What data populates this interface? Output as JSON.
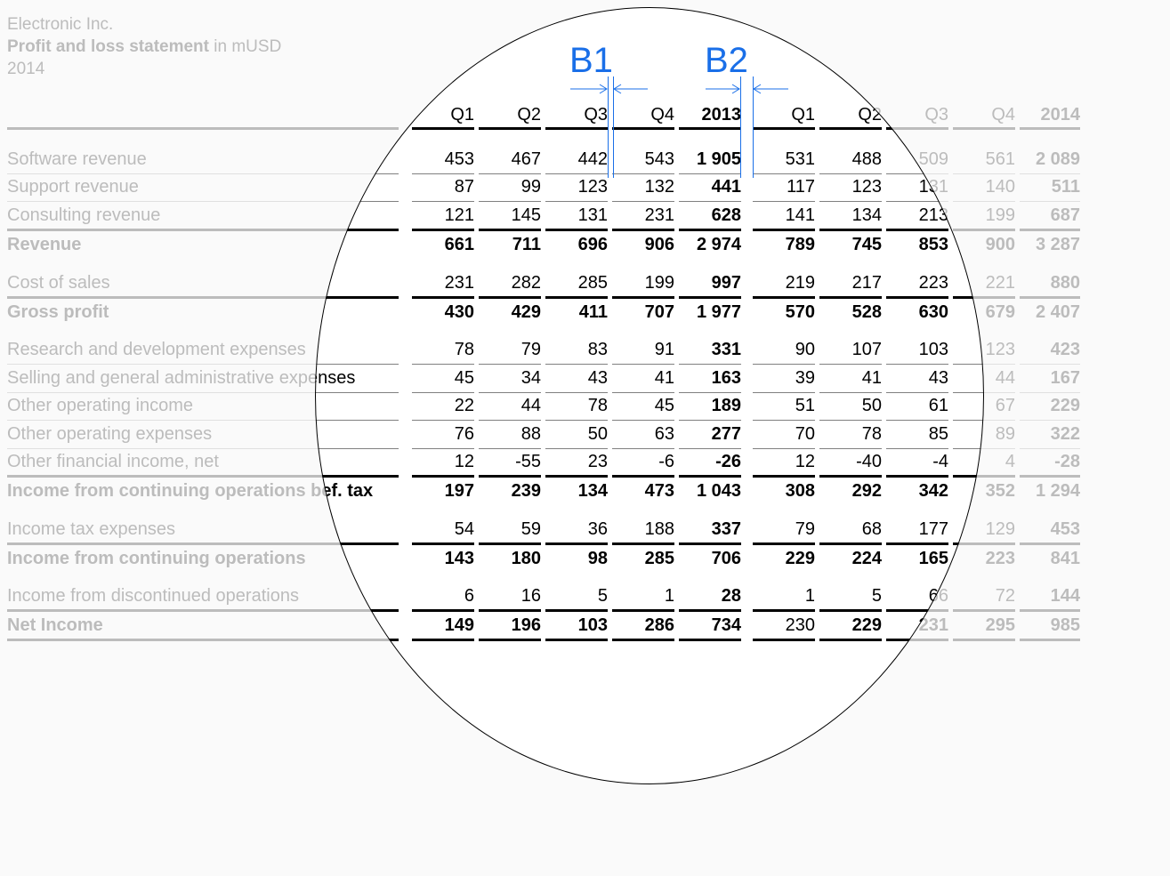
{
  "header": {
    "company": "Electronic Inc.",
    "title_bold": "Profit and loss statement",
    "title_unit": " in mUSD",
    "year": "2014"
  },
  "columns": [
    "Q1",
    "Q2",
    "Q3",
    "Q4",
    "2013",
    "Q1",
    "Q2",
    "Q3",
    "Q4",
    "2014"
  ],
  "markers": {
    "b1": "B1",
    "b2": "B2"
  },
  "rows": [
    {
      "label": "Software revenue",
      "bold": false,
      "values": [
        "453",
        "467",
        "442",
        "543",
        "1 905",
        "531",
        "488",
        "509",
        "561",
        "2 089"
      ]
    },
    {
      "label": "Support revenue",
      "bold": false,
      "values": [
        "87",
        "99",
        "123",
        "132",
        "441",
        "117",
        "123",
        "131",
        "140",
        "511"
      ]
    },
    {
      "label": "Consulting revenue",
      "bold": false,
      "values": [
        "121",
        "145",
        "131",
        "231",
        "628",
        "141",
        "134",
        "213",
        "199",
        "687"
      ]
    },
    {
      "label": "Revenue",
      "bold": true,
      "values": [
        "661",
        "711",
        "696",
        "906",
        "2 974",
        "789",
        "745",
        "853",
        "900",
        "3 287"
      ]
    },
    {
      "label": "Cost of sales",
      "bold": false,
      "values": [
        "231",
        "282",
        "285",
        "199",
        "997",
        "219",
        "217",
        "223",
        "221",
        "880"
      ]
    },
    {
      "label": "Gross profit",
      "bold": true,
      "values": [
        "430",
        "429",
        "411",
        "707",
        "1 977",
        "570",
        "528",
        "630",
        "679",
        "2 407"
      ]
    },
    {
      "label": "Research and development expenses",
      "bold": false,
      "values": [
        "78",
        "79",
        "83",
        "91",
        "331",
        "90",
        "107",
        "103",
        "123",
        "423"
      ]
    },
    {
      "label": "Selling and general administrative expenses",
      "bold": false,
      "values": [
        "45",
        "34",
        "43",
        "41",
        "163",
        "39",
        "41",
        "43",
        "44",
        "167"
      ]
    },
    {
      "label": "Other operating income",
      "bold": false,
      "values": [
        "22",
        "44",
        "78",
        "45",
        "189",
        "51",
        "50",
        "61",
        "67",
        "229"
      ]
    },
    {
      "label": "Other operating expenses",
      "bold": false,
      "values": [
        "76",
        "88",
        "50",
        "63",
        "277",
        "70",
        "78",
        "85",
        "89",
        "322"
      ]
    },
    {
      "label": "Other financial income, net",
      "bold": false,
      "values": [
        "12",
        "-55",
        "23",
        "-6",
        "-26",
        "12",
        "-40",
        "-4",
        "4",
        "-28"
      ]
    },
    {
      "label": "Income from continuing operations bef. tax",
      "bold": true,
      "values": [
        "197",
        "239",
        "134",
        "473",
        "1 043",
        "308",
        "292",
        "342",
        "352",
        "1 294"
      ]
    },
    {
      "label": "Income tax expenses",
      "bold": false,
      "values": [
        "54",
        "59",
        "36",
        "188",
        "337",
        "79",
        "68",
        "177",
        "129",
        "453"
      ]
    },
    {
      "label": "Income from continuing operations",
      "bold": true,
      "values": [
        "143",
        "180",
        "98",
        "285",
        "706",
        "229",
        "224",
        "165",
        "223",
        "841"
      ]
    },
    {
      "label": "Income from discontinued operations",
      "bold": false,
      "values": [
        "6",
        "16",
        "5",
        "1",
        "28",
        "1",
        "5",
        "66",
        "72",
        "144"
      ]
    },
    {
      "label": "Net Income",
      "bold": true,
      "values": [
        "149",
        "196",
        "103",
        "286",
        "734",
        "230",
        "229",
        "231",
        "295",
        "985"
      ]
    }
  ]
}
